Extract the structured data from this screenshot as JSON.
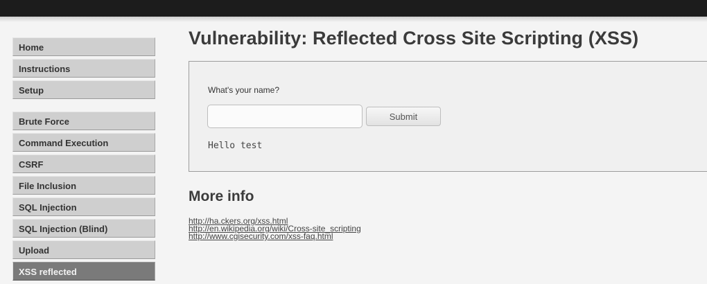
{
  "sidebar": {
    "group1": [
      {
        "label": "Home"
      },
      {
        "label": "Instructions"
      },
      {
        "label": "Setup"
      }
    ],
    "group2": [
      {
        "label": "Brute Force"
      },
      {
        "label": "Command Execution"
      },
      {
        "label": "CSRF"
      },
      {
        "label": "File Inclusion"
      },
      {
        "label": "SQL Injection"
      },
      {
        "label": "SQL Injection (Blind)"
      },
      {
        "label": "Upload"
      },
      {
        "label": "XSS reflected",
        "active": true
      }
    ]
  },
  "main": {
    "title": "Vulnerability: Reflected Cross Site Scripting (XSS)",
    "form": {
      "prompt": "What's your name?",
      "input_value": "",
      "submit_label": "Submit",
      "output": "Hello test"
    },
    "more_info": {
      "heading": "More info",
      "links": [
        "http://ha.ckers.org/xss.html",
        "http://en.wikipedia.org/wiki/Cross-site_scripting",
        "http://www.cgisecurity.com/xss-faq.html"
      ]
    }
  },
  "colors": {
    "topbar": "#1c1c1c",
    "menu_bg": "#cfcfcf",
    "menu_active_bg": "#7a7a7a",
    "page_bg": "#f4f4f4"
  }
}
